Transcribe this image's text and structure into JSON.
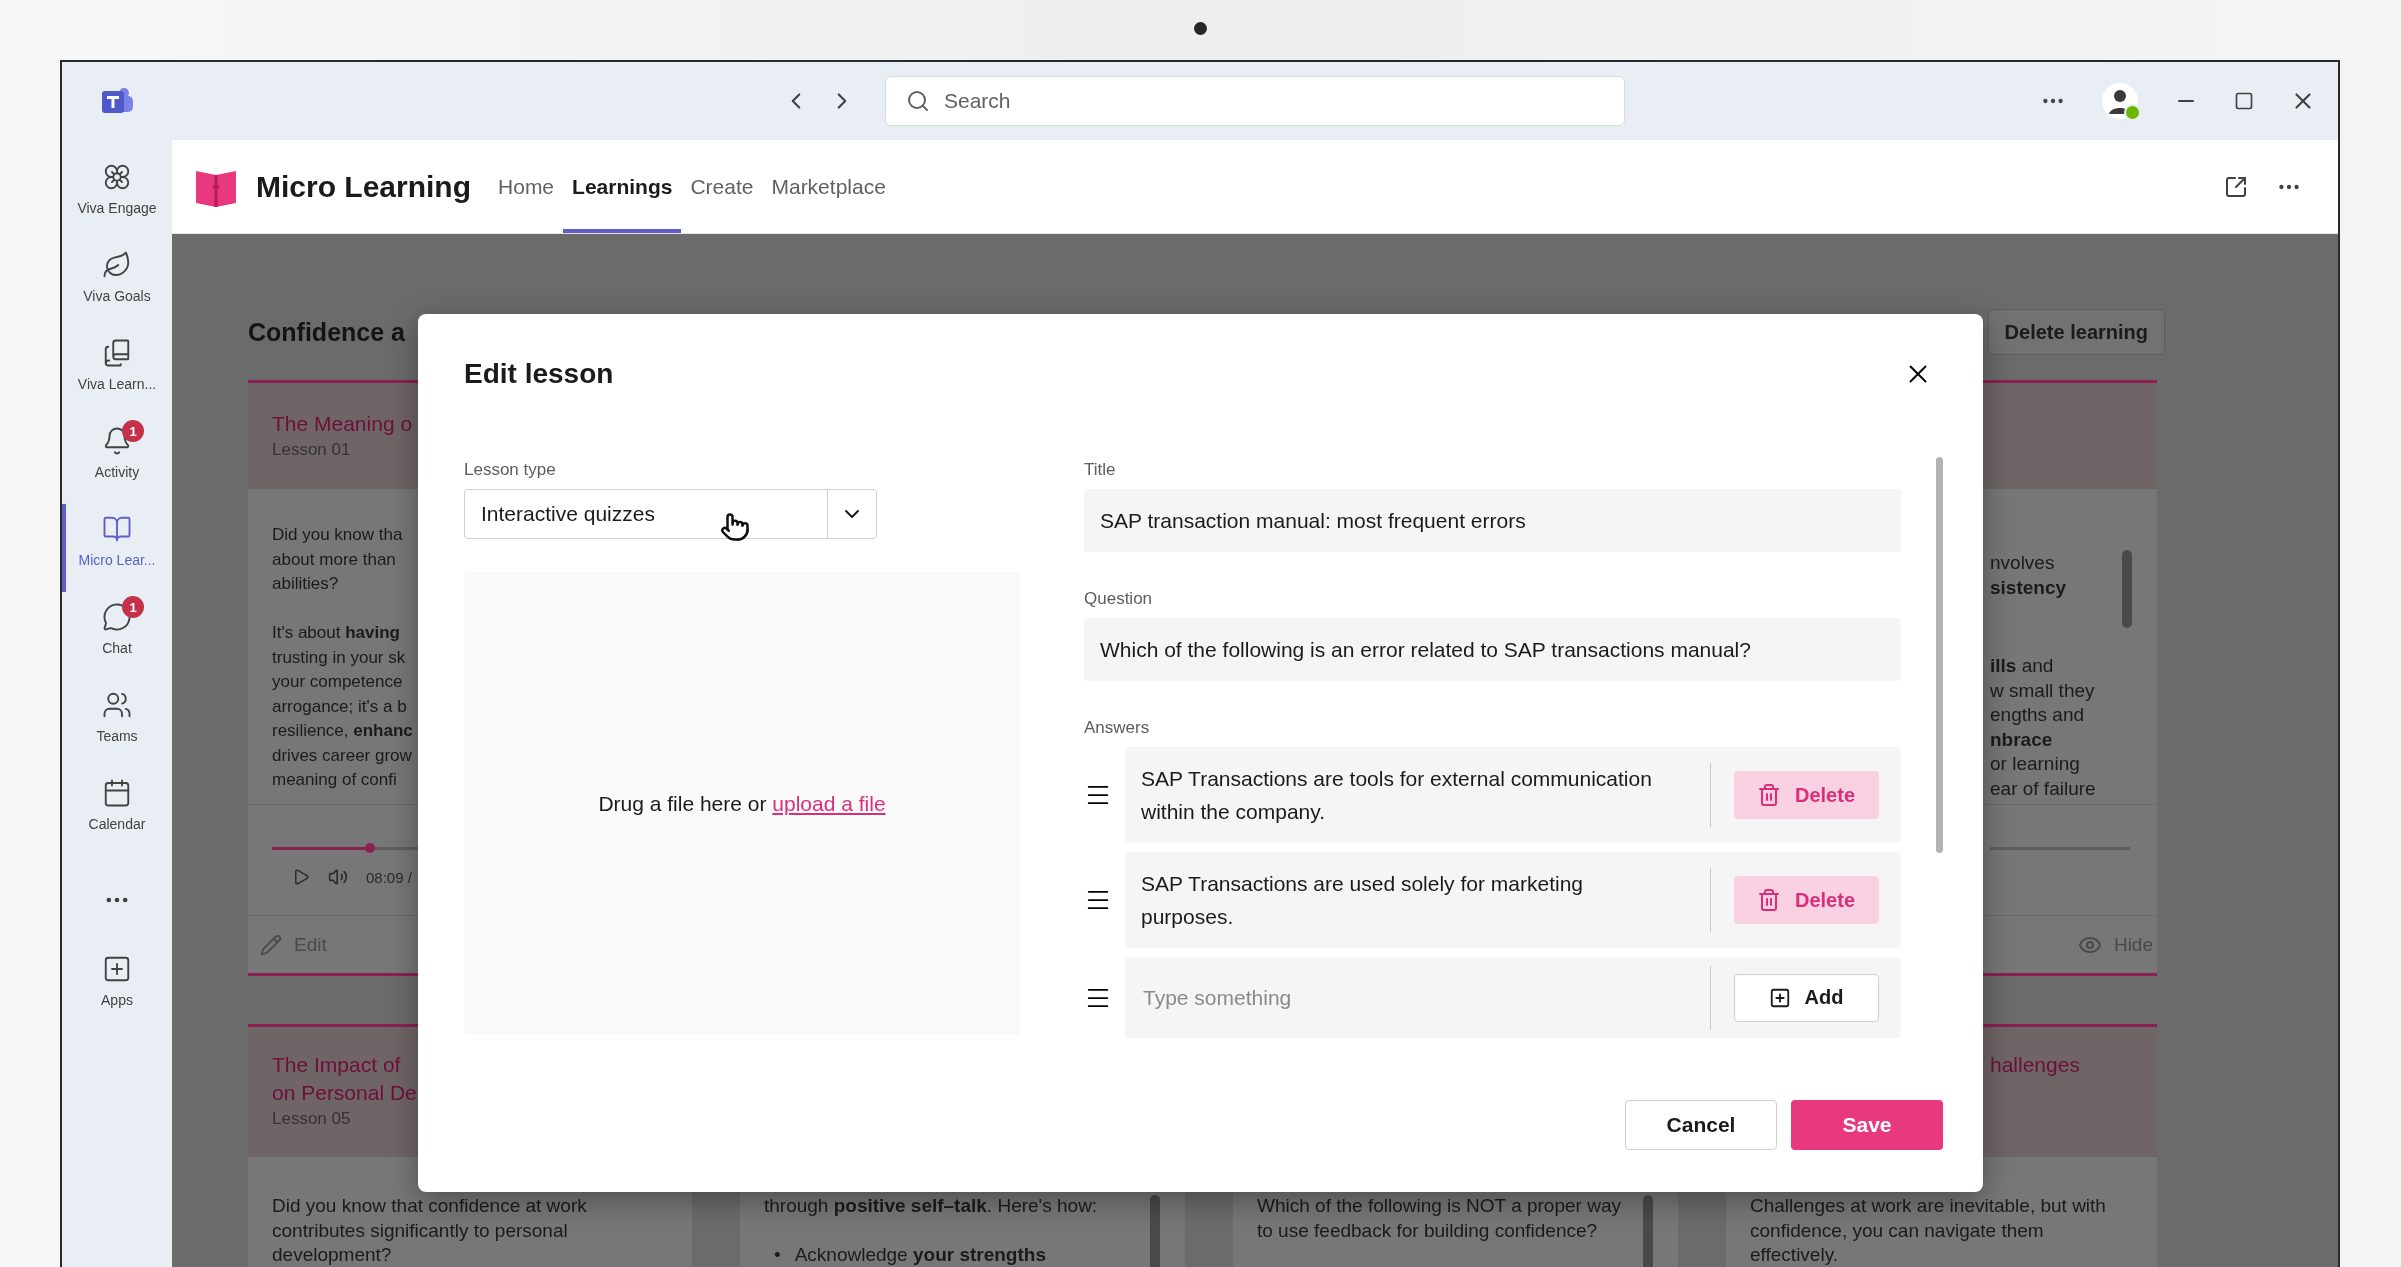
{
  "window": {
    "search_placeholder": "Search"
  },
  "sidebar": {
    "items": [
      {
        "label": "Viva Engage",
        "selected": false
      },
      {
        "label": "Viva Goals",
        "selected": false
      },
      {
        "label": "Viva Learn...",
        "selected": false
      },
      {
        "label": "Activity",
        "selected": false,
        "badge": "1"
      },
      {
        "label": "Micro Lear...",
        "selected": true
      },
      {
        "label": "Chat",
        "selected": false,
        "badge": "1"
      },
      {
        "label": "Teams",
        "selected": false
      },
      {
        "label": "Calendar",
        "selected": false
      }
    ],
    "bottom_items": [
      {
        "label": "Apps",
        "selected": false
      }
    ]
  },
  "app": {
    "name": "Micro Learning",
    "tabs": [
      {
        "label": "Home",
        "selected": false
      },
      {
        "label": "Learnings",
        "selected": true
      },
      {
        "label": "Create",
        "selected": false
      },
      {
        "label": "Marketplace",
        "selected": false
      }
    ]
  },
  "page": {
    "heading": "Confidence a",
    "delete_button": "Delete learning"
  },
  "card_rows": [
    [
      {
        "title_lines": [
          "The Meaning o"
        ],
        "lesson": "Lesson 01",
        "paragraphs": [
          [
            "Did you know tha",
            "about more than",
            "abilities?"
          ],
          [
            "It's about **having**",
            "trusting in your sk",
            "your competence",
            "arrogance; it's a b",
            "resilience, **enhanc**",
            "drives career grow",
            "meaning of confi"
          ]
        ],
        "player": {
          "kind": "audio",
          "level": 0.25,
          "time": "08:09 /"
        },
        "footer": {
          "kind": "edit",
          "label": "Edit"
        }
      },
      {},
      {},
      {
        "paragraphs": [
          [
            "nvolves",
            "**sistency**"
          ],
          [
            "**ills** and",
            "w small they",
            "engths and",
            "**nbrace**",
            "or learning",
            "ear of failure"
          ]
        ],
        "player": {
          "kind": "track"
        },
        "footer": {
          "kind": "hide",
          "label": "Hide"
        }
      }
    ],
    [
      {
        "title_lines": [
          "The Impact of",
          "on Personal De"
        ],
        "lesson": "Lesson 05",
        "paragraphs": [
          [
            "Did you know that confidence at work",
            "contributes significantly to personal",
            "development?"
          ]
        ]
      },
      {
        "paragraphs": [
          [
            "through **positive self–talk**. Here's how:"
          ]
        ],
        "bullets": [
          {
            "marker": "•",
            "text": "Acknowledge **your strengths**"
          }
        ]
      },
      {
        "paragraphs": [
          [
            "Which of the following is NOT a proper way",
            "to use feedback for building confidence?"
          ]
        ]
      },
      {
        "title_lines": [
          "hallenges"
        ],
        "paragraphs": [
          [
            "Challenges at work are inevitable, but with",
            "confidence, you can navigate them",
            "effectively."
          ]
        ]
      }
    ]
  ],
  "dialog": {
    "title": "Edit lesson",
    "lesson_type": {
      "label": "Lesson type",
      "value": "Interactive quizzes"
    },
    "dropzone": {
      "text": "Drug a file here or",
      "link": "upload a file"
    },
    "title_field": {
      "label": "Title",
      "value": "SAP transaction manual: most frequent errors"
    },
    "question_field": {
      "label": "Question",
      "value": "Which of the following is an error related to SAP transactions manual?"
    },
    "answers": {
      "label": "Answers",
      "items": [
        {
          "text": "SAP Transactions are tools for external communication within the company.",
          "action": "Delete"
        },
        {
          "text": "SAP Transactions are used solely for marketing purposes.",
          "action": "Delete"
        }
      ],
      "new": {
        "placeholder": "Type something",
        "action": "Add"
      }
    },
    "buttons": [
      {
        "label": "Cancel",
        "kind": "secondary"
      },
      {
        "label": "Save",
        "kind": "primary"
      }
    ]
  }
}
